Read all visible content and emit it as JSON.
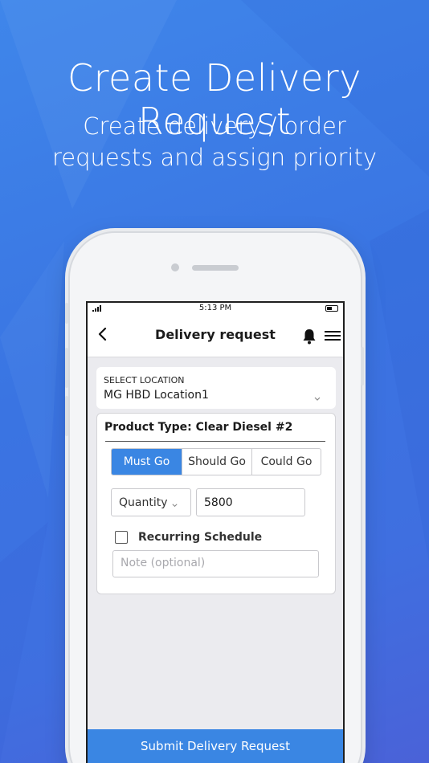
{
  "hero": {
    "title": "Create Delivery Request",
    "subtitle": "Create delivery / order requests and assign priority"
  },
  "status_bar": {
    "time": "5:13 PM",
    "icons": [
      "signal-icon",
      "battery-icon"
    ]
  },
  "nav": {
    "title": "Delivery request",
    "icons": [
      "back-chevron-icon",
      "bell-icon",
      "hamburger-menu-icon"
    ]
  },
  "location": {
    "label": "SELECT LOCATION",
    "value": "MG HBD Location1"
  },
  "product": {
    "title": "Product Type: Clear Diesel #2",
    "priority_options": [
      {
        "label": "Must Go",
        "selected": true
      },
      {
        "label": "Should Go",
        "selected": false
      },
      {
        "label": "Could Go",
        "selected": false
      }
    ],
    "quantity_select": "Quantity",
    "quantity_value": "5800",
    "recurring_label": "Recurring Schedule",
    "recurring_checked": false,
    "note_placeholder": "Note (optional)"
  },
  "submit_label": "Submit Delivery Request",
  "colors": {
    "accent": "#3a86e3",
    "background": "#3f7de6"
  }
}
